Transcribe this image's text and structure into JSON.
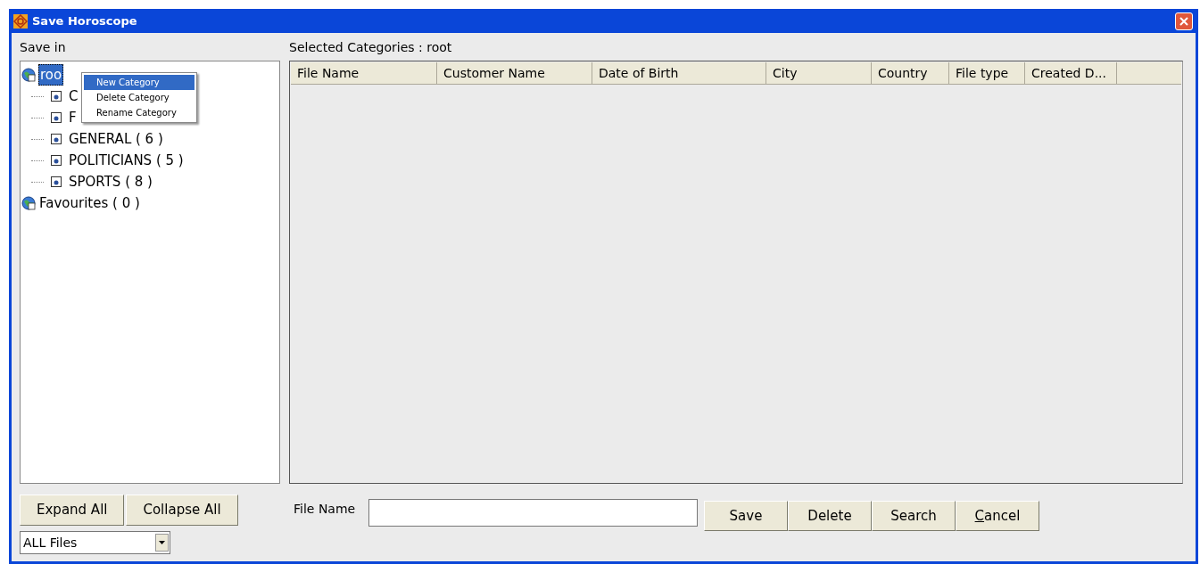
{
  "window": {
    "title": "Save Horoscope"
  },
  "save_in_label": "Save in",
  "tree": [
    {
      "label": "roo",
      "selected": true,
      "children": [
        {
          "label": "C"
        },
        {
          "label": "F"
        },
        {
          "label": "GENERAL ( 6 )"
        },
        {
          "label": "POLITICIANS ( 5 )"
        },
        {
          "label": "SPORTS ( 8 )"
        }
      ]
    },
    {
      "label": "Favourites ( 0 )",
      "selected": false
    }
  ],
  "context_menu": [
    {
      "label": "New Category",
      "selected": true
    },
    {
      "label": "Delete Category",
      "selected": false
    },
    {
      "label": "Rename Category",
      "selected": false
    }
  ],
  "selected_categories": "Selected Categories : root",
  "table": {
    "columns": [
      "File Name",
      "Customer Name",
      "Date of Birth",
      "City",
      "Country",
      "File type",
      "Created D..."
    ]
  },
  "tree_buttons": [
    "Expand All",
    "Collapse All"
  ],
  "filter": {
    "value": "ALL Files"
  },
  "file_name": {
    "label": "File Name"
  },
  "buttons": [
    {
      "label": "Save",
      "accelerator": false
    },
    {
      "label": "Delete",
      "accelerator": false
    },
    {
      "label": "Search",
      "accelerator": false
    },
    {
      "label": "Cancel",
      "accelerator": true
    }
  ]
}
